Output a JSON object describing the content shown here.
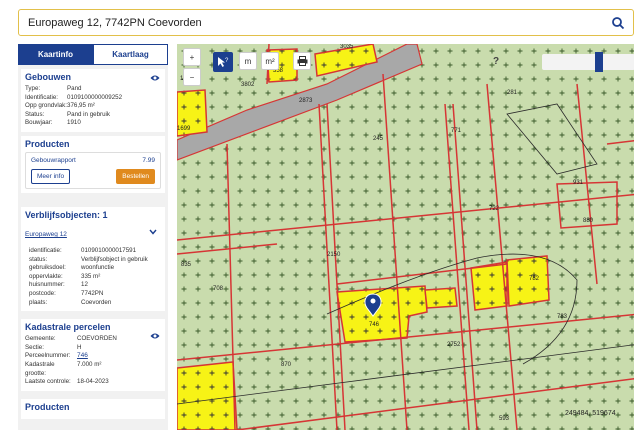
{
  "search": {
    "value": "Europaweg 12, 7742PN Coevorden",
    "icon": "search-icon"
  },
  "tabs": [
    {
      "label": "Kaartinfo",
      "active": true
    },
    {
      "label": "Kaartlaag",
      "active": false
    }
  ],
  "gebouwen": {
    "title": "Gebouwen",
    "rows": [
      {
        "k": "Type:",
        "v": "Pand"
      },
      {
        "k": "Identificatie:",
        "v": "0109100000009252"
      },
      {
        "k": "Opp grondvlak:",
        "v": "376,95 m²"
      },
      {
        "k": "Status:",
        "v": "Pand in gebruik"
      },
      {
        "k": "Bouwjaar:",
        "v": "1910"
      }
    ]
  },
  "producten": {
    "title": "Producten",
    "item": "Gebouwrapport",
    "price": "7.99",
    "meer_info": "Meer info",
    "bestellen": "Bestellen"
  },
  "verblijfsobjecten": {
    "title": "Verblijfsobjecten: 1",
    "link": "Europaweg 12",
    "rows": [
      {
        "k": "identificatie:",
        "v": "0109010000017591"
      },
      {
        "k": "status:",
        "v": "Verblijfsobject in gebruik"
      },
      {
        "k": "gebruiksdoel:",
        "v": "woonfunctie"
      },
      {
        "k": "oppervlakte:",
        "v": "335 m²"
      },
      {
        "k": "huisnummer:",
        "v": "12"
      },
      {
        "k": "postcode:",
        "v": "7742PN"
      },
      {
        "k": "plaats:",
        "v": "Coevorden"
      }
    ]
  },
  "kadastrale": {
    "title": "Kadastrale percelen",
    "rows": [
      {
        "k": "Gemeente:",
        "v": "COEVORDEN"
      },
      {
        "k": "Sectie:",
        "v": "H"
      },
      {
        "k": "Perceelnummer:",
        "v": "746"
      },
      {
        "k": "Kadastrale grootte:",
        "v": "7.000 m²"
      },
      {
        "k": "Laatste controle:",
        "v": "18-04-2023"
      }
    ]
  },
  "next_section_partial": "Producten",
  "map": {
    "tools": {
      "zoom_in": "+",
      "zoom_out": "−",
      "select": "?",
      "measure_line": "m",
      "measure_area": "m²",
      "print": "print-icon",
      "help": "?"
    },
    "parcel_labels": [
      "3035",
      "1804",
      "3802",
      "358",
      "2873",
      "281",
      "1699",
      "245",
      "771",
      "722",
      "931",
      "880",
      "835",
      "708",
      "2150",
      "782",
      "746",
      "783",
      "870",
      "2752",
      "593"
    ],
    "coordinates": "249484, 519674",
    "colors": {
      "land": "#c9dcad",
      "building": "#f7f316",
      "boundary": "#d63535",
      "road": "#a8a8a8",
      "accent": "#1c3f8f",
      "orange": "#e08a1e"
    }
  }
}
